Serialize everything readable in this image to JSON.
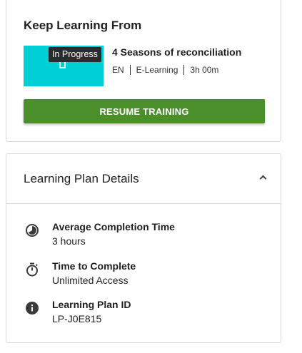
{
  "keep_learning": {
    "title": "Keep Learning From",
    "course": {
      "status_badge": "In Progress",
      "title": "4 Seasons of reconciliation",
      "language": "EN",
      "type": "E-Learning",
      "duration": "3h 00m",
      "thumbnail_color": "#00d0d5"
    },
    "resume_label": "RESUME TRAINING",
    "resume_color": "#4b8f2a"
  },
  "plan_details": {
    "title": "Learning Plan Details",
    "toggle_icon": "chevron-up-icon",
    "items": [
      {
        "icon": "pie-clock-icon",
        "label": "Average Completion Time",
        "value": "3 hours"
      },
      {
        "icon": "stopwatch-icon",
        "label": "Time to Complete",
        "value": "Unlimited Access"
      },
      {
        "icon": "info-icon",
        "label": "Learning Plan ID",
        "value": "LP-J0E815"
      }
    ]
  }
}
